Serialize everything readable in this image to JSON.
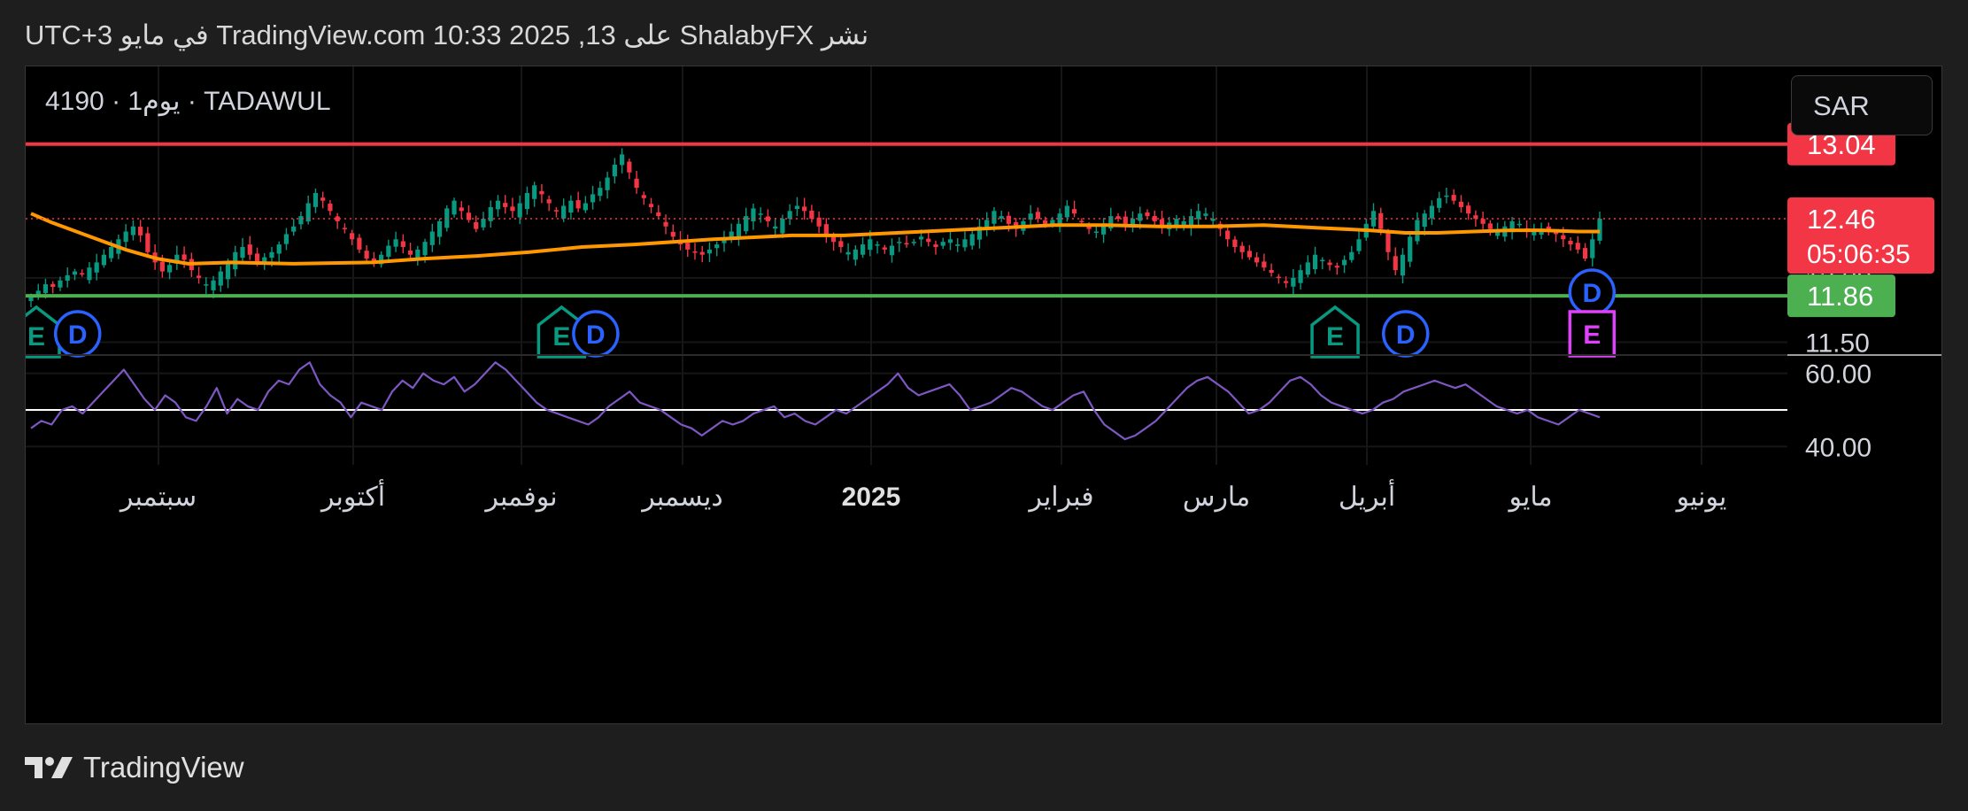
{
  "header": {
    "published_text": "نشر ShalabyFX على TradingView.com 10:33 2025 ,13 في مايو UTC+3"
  },
  "symbol": {
    "info": "4190 · يوم1 · TADAWUL",
    "currency": "SAR"
  },
  "footer": {
    "brand": "TradingView",
    "logo_icon": "tradingview-logo-icon"
  },
  "colors": {
    "background": "#000000",
    "resistance": "#f23645",
    "support": "#4caf50",
    "moving_average": "#ff9800",
    "candle_up": "#089981",
    "candle_down": "#f23645",
    "oscillator": "#7e57c2",
    "current_price": "#f23645",
    "earnings_marker": "#089981",
    "dividend_marker": "#2962ff",
    "upcoming_earnings_marker": "#e040fb"
  },
  "chart_data": {
    "type": "candlestick",
    "price_axis": {
      "range": [
        11.4,
        13.3
      ],
      "ticks": [
        {
          "value": 12.0,
          "label": "12.00"
        },
        {
          "value": 11.5,
          "label": "11.50"
        }
      ]
    },
    "time_axis": {
      "labels": [
        "سبتمبر",
        "أكتوبر",
        "نوفمبر",
        "ديسمبر",
        "2025",
        "فبراير",
        "مارس",
        "أبريل",
        "مايو",
        "يونيو"
      ],
      "emphasized": "2025"
    },
    "horizontal_lines": [
      {
        "role": "resistance",
        "value": 13.04,
        "label": "13.04"
      },
      {
        "role": "support",
        "value": 11.86,
        "label": "11.86"
      }
    ],
    "current_price": {
      "value": 12.46,
      "label": "12.46",
      "countdown": "05:06:35"
    },
    "moving_average": [
      {
        "t": 0,
        "v": 12.5
      },
      {
        "t": 4,
        "v": 12.43
      },
      {
        "t": 10,
        "v": 12.34
      },
      {
        "t": 18,
        "v": 12.22
      },
      {
        "t": 24,
        "v": 12.15
      },
      {
        "t": 30,
        "v": 12.11
      },
      {
        "t": 38,
        "v": 12.12
      },
      {
        "t": 50,
        "v": 12.11
      },
      {
        "t": 65,
        "v": 12.12
      },
      {
        "t": 75,
        "v": 12.15
      },
      {
        "t": 85,
        "v": 12.17
      },
      {
        "t": 95,
        "v": 12.2
      },
      {
        "t": 105,
        "v": 12.24
      },
      {
        "t": 115,
        "v": 12.26
      },
      {
        "t": 130,
        "v": 12.3
      },
      {
        "t": 145,
        "v": 12.33
      },
      {
        "t": 155,
        "v": 12.33
      },
      {
        "t": 165,
        "v": 12.35
      },
      {
        "t": 175,
        "v": 12.37
      },
      {
        "t": 185,
        "v": 12.39
      },
      {
        "t": 195,
        "v": 12.41
      },
      {
        "t": 205,
        "v": 12.41
      },
      {
        "t": 215,
        "v": 12.4
      },
      {
        "t": 225,
        "v": 12.4
      },
      {
        "t": 235,
        "v": 12.41
      },
      {
        "t": 245,
        "v": 12.39
      },
      {
        "t": 255,
        "v": 12.37
      },
      {
        "t": 262,
        "v": 12.35
      },
      {
        "t": 268,
        "v": 12.35
      },
      {
        "t": 275,
        "v": 12.36
      },
      {
        "t": 282,
        "v": 12.37
      },
      {
        "t": 288,
        "v": 12.37
      },
      {
        "t": 295,
        "v": 12.36
      },
      {
        "t": 299,
        "v": 12.36
      }
    ],
    "candles_close": [
      11.85,
      11.9,
      11.95,
      11.93,
      11.98,
      12.02,
      12.05,
      12.03,
      12.08,
      12.12,
      12.18,
      12.24,
      12.3,
      12.36,
      12.4,
      12.33,
      12.2,
      12.12,
      12.05,
      12.1,
      12.18,
      12.14,
      12.06,
      12.0,
      11.95,
      11.98,
      12.05,
      12.12,
      12.2,
      12.24,
      12.18,
      12.12,
      12.16,
      12.2,
      12.26,
      12.34,
      12.4,
      12.48,
      12.58,
      12.66,
      12.6,
      12.52,
      12.44,
      12.38,
      12.3,
      12.22,
      12.15,
      12.12,
      12.18,
      12.25,
      12.3,
      12.24,
      12.18,
      12.22,
      12.28,
      12.36,
      12.44,
      12.54,
      12.6,
      12.52,
      12.45,
      12.38,
      12.46,
      12.55,
      12.6,
      12.55,
      12.52,
      12.58,
      12.66,
      12.72,
      12.65,
      12.58,
      12.52,
      12.56,
      12.6,
      12.54,
      12.58,
      12.65,
      12.7,
      12.78,
      12.88,
      12.96,
      12.82,
      12.7,
      12.62,
      12.55,
      12.48,
      12.4,
      12.32,
      12.26,
      12.22,
      12.2,
      12.18,
      12.22,
      12.26,
      12.3,
      12.36,
      12.42,
      12.48,
      12.54,
      12.5,
      12.44,
      12.4,
      12.46,
      12.52,
      12.56,
      12.52,
      12.46,
      12.4,
      12.34,
      12.28,
      12.24,
      12.2,
      12.22,
      12.26,
      12.3,
      12.26,
      12.22,
      12.25,
      12.28,
      12.26,
      12.28,
      12.32,
      12.28,
      12.24,
      12.28,
      12.3,
      12.26,
      12.3,
      12.34,
      12.4,
      12.45,
      12.52,
      12.48,
      12.42,
      12.38,
      12.44,
      12.5,
      12.46,
      12.42,
      12.45,
      12.5,
      12.56,
      12.5,
      12.44,
      12.38,
      12.36,
      12.42,
      12.48,
      12.46,
      12.42,
      12.46,
      12.5,
      12.48,
      12.44,
      12.4,
      12.43,
      12.46,
      12.44,
      12.48,
      12.52,
      12.5,
      12.46,
      12.38,
      12.3,
      12.24,
      12.2,
      12.16,
      12.12,
      12.08,
      12.04,
      12.0,
      11.96,
      12.0,
      12.06,
      12.12,
      12.18,
      12.14,
      12.1,
      12.08,
      12.14,
      12.2,
      12.3,
      12.42,
      12.52,
      12.38,
      12.2,
      12.06,
      12.18,
      12.32,
      12.45,
      12.5,
      12.56,
      12.62,
      12.64,
      12.6,
      12.55,
      12.5,
      12.46,
      12.42,
      12.38,
      12.36,
      12.4,
      12.44,
      12.42,
      12.38,
      12.36,
      12.38,
      12.36,
      12.34,
      12.3,
      12.26,
      12.22,
      12.15,
      12.3,
      12.46
    ],
    "events": [
      {
        "kind": "earnings",
        "label": "E",
        "x_index": 0
      },
      {
        "kind": "dividend",
        "label": "D",
        "x_index": 3
      },
      {
        "kind": "earnings",
        "label": "E",
        "x_index": 72
      },
      {
        "kind": "dividend",
        "label": "D",
        "x_index": 74
      },
      {
        "kind": "earnings",
        "label": "E",
        "x_index": 178
      },
      {
        "kind": "dividend",
        "label": "D",
        "x_index": 185
      },
      {
        "kind": "dividend",
        "label": "D",
        "x_index": 212
      },
      {
        "kind": "earnings",
        "label": "E",
        "x_index": 212
      }
    ],
    "oscillator": {
      "range": [
        35,
        65
      ],
      "ticks": [
        {
          "value": 60,
          "label": "60.00"
        },
        {
          "value": 40,
          "label": "40.00"
        }
      ],
      "midline": 50,
      "values": [
        45,
        47,
        46,
        50,
        51,
        49,
        52,
        55,
        58,
        61,
        57,
        53,
        50,
        54,
        52,
        48,
        47,
        51,
        56,
        49,
        53,
        51,
        50,
        55,
        58,
        57,
        61,
        63,
        57,
        54,
        52,
        48,
        52,
        51,
        50,
        55,
        58,
        56,
        60,
        58,
        57,
        59,
        55,
        57,
        60,
        63,
        61,
        58,
        55,
        52,
        50,
        49,
        48,
        47,
        46,
        48,
        51,
        53,
        55,
        52,
        51,
        50,
        48,
        46,
        45,
        43,
        45,
        47,
        46,
        47,
        49,
        50,
        51,
        48,
        49,
        47,
        46,
        48,
        50,
        49,
        51,
        53,
        55,
        57,
        60,
        56,
        54,
        55,
        56,
        57,
        54,
        50,
        51,
        52,
        54,
        56,
        55,
        53,
        51,
        50,
        52,
        54,
        55,
        50,
        46,
        44,
        42,
        43,
        45,
        47,
        50,
        53,
        56,
        58,
        59,
        57,
        55,
        52,
        49,
        50,
        52,
        55,
        58,
        59,
        57,
        54,
        52,
        51,
        50,
        49,
        50,
        52,
        53,
        55,
        56,
        57,
        58,
        57,
        56,
        57,
        55,
        53,
        51,
        50,
        49,
        50,
        48,
        47,
        46,
        48,
        50,
        49,
        48
      ]
    }
  }
}
